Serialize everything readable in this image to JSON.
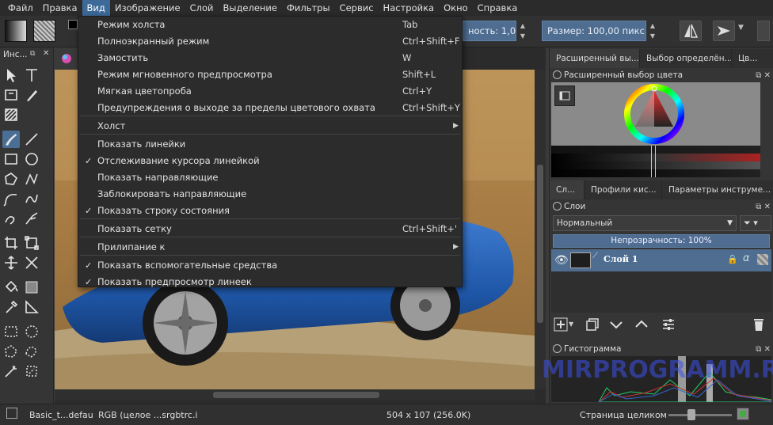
{
  "menubar": [
    "Файл",
    "Правка",
    "Вид",
    "Изображение",
    "Слой",
    "Выделение",
    "Фильтры",
    "Сервис",
    "Настройка",
    "Окно",
    "Справка"
  ],
  "toolbar": {
    "opacity_label": "ность:  1,00",
    "size_label": "Размер:  100,00 пикс."
  },
  "toolbox": {
    "title": "Инс..."
  },
  "view_menu": {
    "items": [
      {
        "label": "Режим холста",
        "shortcut": "Tab"
      },
      {
        "label": "Полноэкранный режим",
        "shortcut": "Ctrl+Shift+F"
      },
      {
        "label": "Замостить",
        "shortcut": "W"
      },
      {
        "label": "Режим мгновенного предпросмотра",
        "shortcut": "Shift+L"
      },
      {
        "label": "Мягкая цветопроба",
        "shortcut": "Ctrl+Y"
      },
      {
        "label": "Предупреждения о выходе за пределы цветового охвата",
        "shortcut": "Ctrl+Shift+Y"
      },
      {
        "label": "Холст",
        "shortcut": ""
      },
      {
        "label": "Показать линейки",
        "shortcut": ""
      },
      {
        "label": "Отслеживание курсора линейкой",
        "shortcut": "",
        "checked": true
      },
      {
        "label": "Показать направляющие",
        "shortcut": ""
      },
      {
        "label": "Заблокировать направляющие",
        "shortcut": ""
      },
      {
        "label": "Показать строку состояния",
        "shortcut": "",
        "checked": true
      },
      {
        "label": "Показать сетку",
        "shortcut": "Ctrl+Shift+'"
      },
      {
        "label": "Прилипание к",
        "shortcut": ""
      },
      {
        "label": "Показать вспомогательные средства",
        "shortcut": "",
        "checked": true
      },
      {
        "label": "Показать предпросмотр линеек",
        "shortcut": "",
        "checked": true
      }
    ]
  },
  "right": {
    "top_tabs": [
      "Расширенный вы...",
      "Выбор определён...",
      "Цв..."
    ],
    "color_selector_title": "Расширенный выбор цвета",
    "mid_tabs": [
      "Сл...",
      "Профили кис...",
      "Параметры инструме..."
    ],
    "layers_title": "Слои",
    "blend_mode": "Нормальный",
    "opacity": "Непрозрачность:  100%",
    "layer_name": "Слой 1",
    "histogram_title": "Гистограмма"
  },
  "status": {
    "brush": "Basic_t...defau",
    "colorspace": "RGB (целое ...srgbtrc.i",
    "dimensions": "504 x 107 (256.0K)",
    "zoom_mode": "Страница целиком"
  },
  "watermark": "MIRPROGRAMM.RU"
}
